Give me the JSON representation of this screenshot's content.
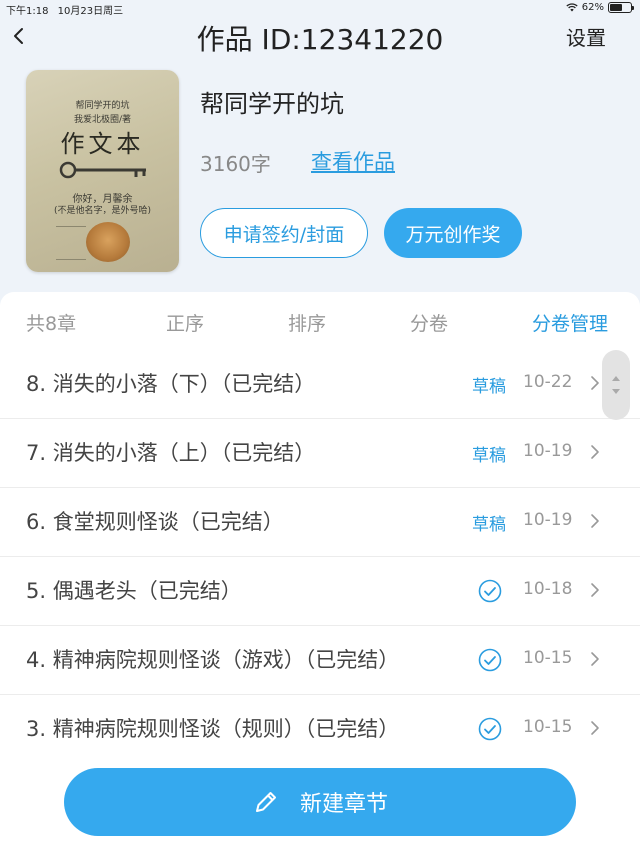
{
  "status_bar": {
    "time": "下午1:18",
    "date": "10月23日周三",
    "battery": "62%",
    "battery_level": 0.62
  },
  "nav": {
    "title": "作品 ID:12341220",
    "settings_label": "设置",
    "back_icon": "chevron-left-icon"
  },
  "work": {
    "title": "帮同学开的坑",
    "word_count": "3160字",
    "view_link": "查看作品",
    "cover": {
      "line1": "帮同学开的坑",
      "line2": "我爱北极圈/著",
      "line3": "作文本",
      "line4": "你好，月馨余",
      "line5": "(不是他名字，是外号哈)"
    }
  },
  "buttons": {
    "sign": "申请签约/封面",
    "award": "万元创作奖",
    "new_chapter": "新建章节"
  },
  "tabs": [
    {
      "label": "共8章",
      "active": false
    },
    {
      "label": "正序",
      "active": false
    },
    {
      "label": "排序",
      "active": false
    },
    {
      "label": "分卷",
      "active": false
    },
    {
      "label": "分卷管理",
      "active": true
    }
  ],
  "chapters": [
    {
      "title": "8. 消失的小落（下）（已完结）",
      "status": "草稿",
      "date": "10-22"
    },
    {
      "title": "7. 消失的小落（上）（已完结）",
      "status": "草稿",
      "date": "10-19"
    },
    {
      "title": "6. 食堂规则怪谈（已完结）",
      "status": "草稿",
      "date": "10-19"
    },
    {
      "title": "5. 偶遇老头（已完结）",
      "status": "check",
      "date": "10-18"
    },
    {
      "title": "4. 精神病院规则怪谈（游戏）（已完结）",
      "status": "check",
      "date": "10-15"
    },
    {
      "title": "3. 精神病院规则怪谈（规则）（已完结）",
      "status": "check",
      "date": "10-15"
    }
  ],
  "colors": {
    "accent": "#35a9ee",
    "link": "#2a9cdf",
    "background": "#eef3f9"
  }
}
